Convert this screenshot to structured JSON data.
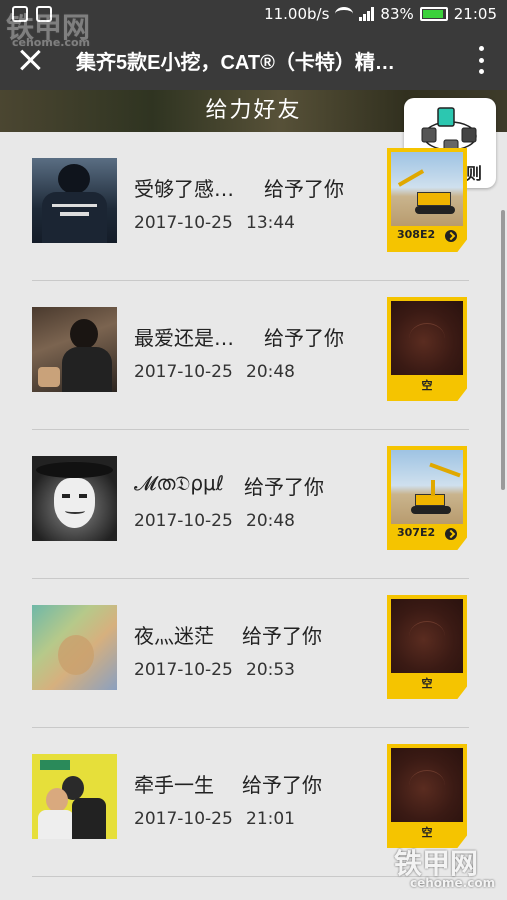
{
  "status_bar": {
    "speed": "11.00b/s",
    "battery": "83%",
    "time": "21:05"
  },
  "title_bar": {
    "title": "集齐5款E小挖，CAT®（卡特）精…"
  },
  "banner": {
    "title": "给力好友",
    "rules_button": "活动规则"
  },
  "friends": [
    {
      "name": "受够了感…",
      "action": "给予了你",
      "date": "2017-10-25",
      "time": "13:44",
      "card": "308E2",
      "card_type": "model"
    },
    {
      "name": "最爱还是…",
      "action": "给予了你",
      "date": "2017-10-25",
      "time": "20:48",
      "card": "空",
      "card_type": "empty"
    },
    {
      "name": "𝓜ത𝔇ρμℓ",
      "action": "给予了你",
      "date": "2017-10-25",
      "time": "20:48",
      "card": "307E2",
      "card_type": "model"
    },
    {
      "name": "夜灬迷茫",
      "action": "给予了你",
      "date": "2017-10-25",
      "time": "20:53",
      "card": "空",
      "card_type": "empty"
    },
    {
      "name": "牵手一生",
      "action": "给予了你",
      "date": "2017-10-25",
      "time": "21:01",
      "card": "空",
      "card_type": "empty"
    }
  ],
  "watermark": {
    "text": "铁甲网",
    "sub": "cehome.com"
  },
  "colors": {
    "card_yellow": "#f5c400",
    "titlebar": "#3a3a3a"
  }
}
